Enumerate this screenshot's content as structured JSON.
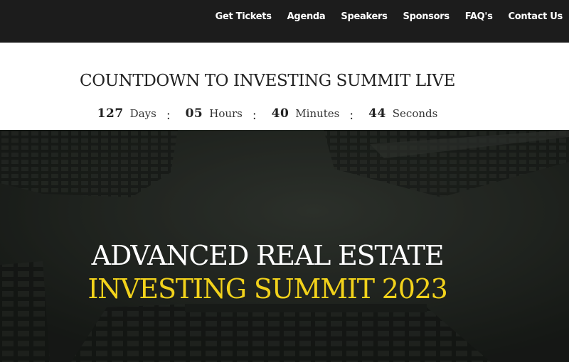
{
  "nav": {
    "items": [
      {
        "label": "Get Tickets"
      },
      {
        "label": "Agenda"
      },
      {
        "label": "Speakers"
      },
      {
        "label": "Sponsors"
      },
      {
        "label": "FAQ's"
      },
      {
        "label": "Contact Us"
      }
    ]
  },
  "countdown": {
    "title": "COUNTDOWN TO INVESTING SUMMIT LIVE",
    "days": {
      "value": "127",
      "unit": "Days"
    },
    "hours": {
      "value": "05",
      "unit": "Hours"
    },
    "minutes": {
      "value": "40",
      "unit": "Minutes"
    },
    "seconds": {
      "value": "44",
      "unit": "Seconds"
    },
    "separator": ":"
  },
  "hero": {
    "line1": "ADVANCED REAL ESTATE",
    "line2": "INVESTING SUMMIT 2023"
  },
  "colors": {
    "nav_bg": "#1c1c1c",
    "accent_yellow": "#f2d21b",
    "hero_text": "#ffffff",
    "countdown_text": "#222222"
  }
}
